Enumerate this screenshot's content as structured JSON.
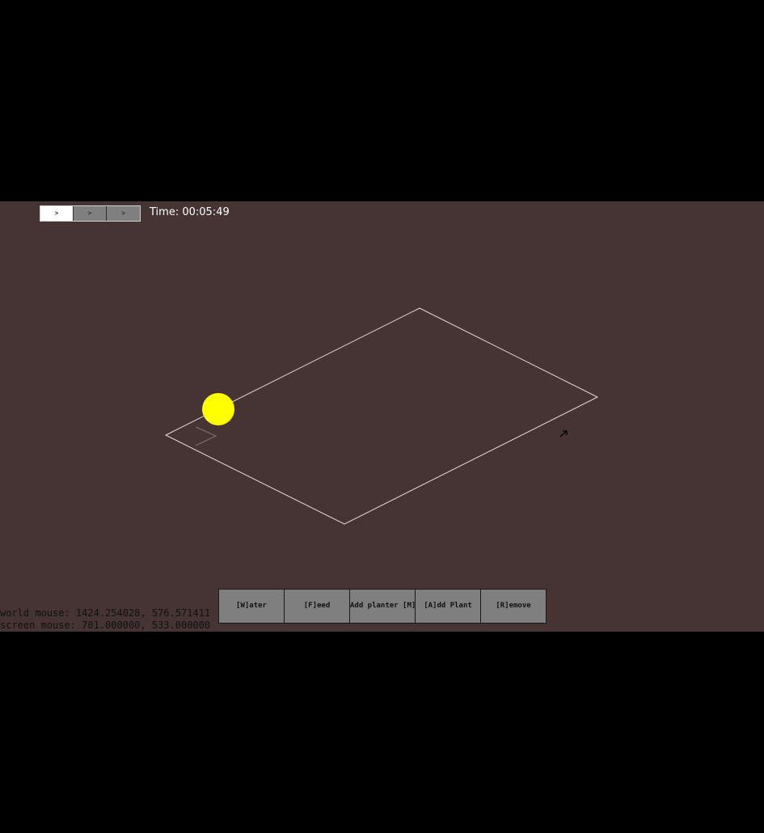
{
  "speed_controls": {
    "buttons": [
      {
        "label": ">",
        "active": true
      },
      {
        "label": ">",
        "active": false
      },
      {
        "label": ">",
        "active": false
      }
    ]
  },
  "time": {
    "label": "Time:",
    "value": "00:05:49"
  },
  "toolbar": {
    "water": "[W]ater",
    "feed": "[F]eed",
    "add_planter": "Add planter [M]",
    "add_plant": "[A]dd Plant",
    "remove": "[R]emove"
  },
  "debug": {
    "world_mouse": "world mouse: 1424.254028, 576.571411",
    "screen_mouse": "screen mouse: 701.000000, 533.000000"
  },
  "colors": {
    "background": "#463333",
    "letterbox": "#000000",
    "grid_outline": "#e8dede",
    "sun": "#ffff00",
    "button": "#7f7f7f"
  },
  "icons": {
    "sun": "sun-icon",
    "cursor": "arrow-cursor-icon"
  }
}
